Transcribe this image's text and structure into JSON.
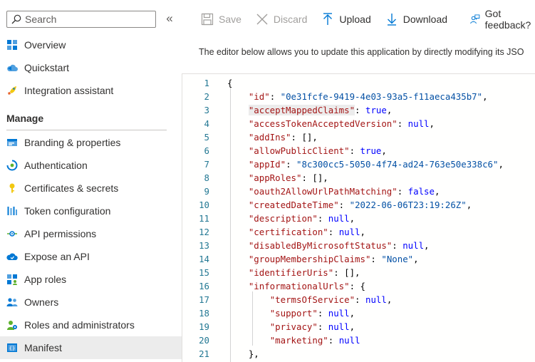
{
  "sidebar": {
    "search_placeholder": "Search",
    "collapse_label": "«",
    "items_top": [
      {
        "label": "Overview",
        "icon": "overview-grid-icon"
      },
      {
        "label": "Quickstart",
        "icon": "cloud-quickstart-icon"
      },
      {
        "label": "Integration assistant",
        "icon": "rocket-icon"
      }
    ],
    "manage_heading": "Manage",
    "items_manage": [
      {
        "label": "Branding & properties",
        "icon": "branding-icon"
      },
      {
        "label": "Authentication",
        "icon": "authentication-icon"
      },
      {
        "label": "Certificates & secrets",
        "icon": "key-icon"
      },
      {
        "label": "Token configuration",
        "icon": "token-bars-icon"
      },
      {
        "label": "API permissions",
        "icon": "api-permissions-icon"
      },
      {
        "label": "Expose an API",
        "icon": "cloud-api-icon"
      },
      {
        "label": "App roles",
        "icon": "app-roles-icon"
      },
      {
        "label": "Owners",
        "icon": "owners-icon"
      },
      {
        "label": "Roles and administrators",
        "icon": "roles-admins-icon"
      },
      {
        "label": "Manifest",
        "icon": "manifest-icon",
        "selected": true
      }
    ]
  },
  "toolbar": {
    "save_label": "Save",
    "discard_label": "Discard",
    "upload_label": "Upload",
    "download_label": "Download",
    "feedback_label": "Got feedback?"
  },
  "description": "The editor below allows you to update this application by directly modifying its JSO",
  "editor": {
    "lines": [
      {
        "n": "1",
        "text": "{"
      },
      {
        "n": "2",
        "text": "    \"id\": \"0e31fcfe-9419-4e03-93a5-f11aeca435b7\","
      },
      {
        "n": "3",
        "text": "    \"acceptMappedClaims\": true,"
      },
      {
        "n": "4",
        "text": "    \"accessTokenAcceptedVersion\": null,"
      },
      {
        "n": "5",
        "text": "    \"addIns\": [],"
      },
      {
        "n": "6",
        "text": "    \"allowPublicClient\": true,"
      },
      {
        "n": "7",
        "text": "    \"appId\": \"8c300cc5-5050-4f74-ad24-763e50e338c6\","
      },
      {
        "n": "8",
        "text": "    \"appRoles\": [],"
      },
      {
        "n": "9",
        "text": "    \"oauth2AllowUrlPathMatching\": false,"
      },
      {
        "n": "10",
        "text": "    \"createdDateTime\": \"2022-06-06T23:19:26Z\","
      },
      {
        "n": "11",
        "text": "    \"description\": null,"
      },
      {
        "n": "12",
        "text": "    \"certification\": null,"
      },
      {
        "n": "13",
        "text": "    \"disabledByMicrosoftStatus\": null,"
      },
      {
        "n": "14",
        "text": "    \"groupMembershipClaims\": \"None\","
      },
      {
        "n": "15",
        "text": "    \"identifierUris\": [],"
      },
      {
        "n": "16",
        "text": "    \"informationalUrls\": {"
      },
      {
        "n": "17",
        "text": "        \"termsOfService\": null,"
      },
      {
        "n": "18",
        "text": "        \"support\": null,"
      },
      {
        "n": "19",
        "text": "        \"privacy\": null,"
      },
      {
        "n": "20",
        "text": "        \"marketing\": null"
      },
      {
        "n": "21",
        "text": "    },"
      }
    ]
  },
  "colors": {
    "accent": "#0078d4",
    "selected_bg": "#ececec",
    "json_key": "#a31515",
    "json_string": "#0451a5",
    "json_keyword": "#0000ff",
    "line_number": "#237893"
  }
}
